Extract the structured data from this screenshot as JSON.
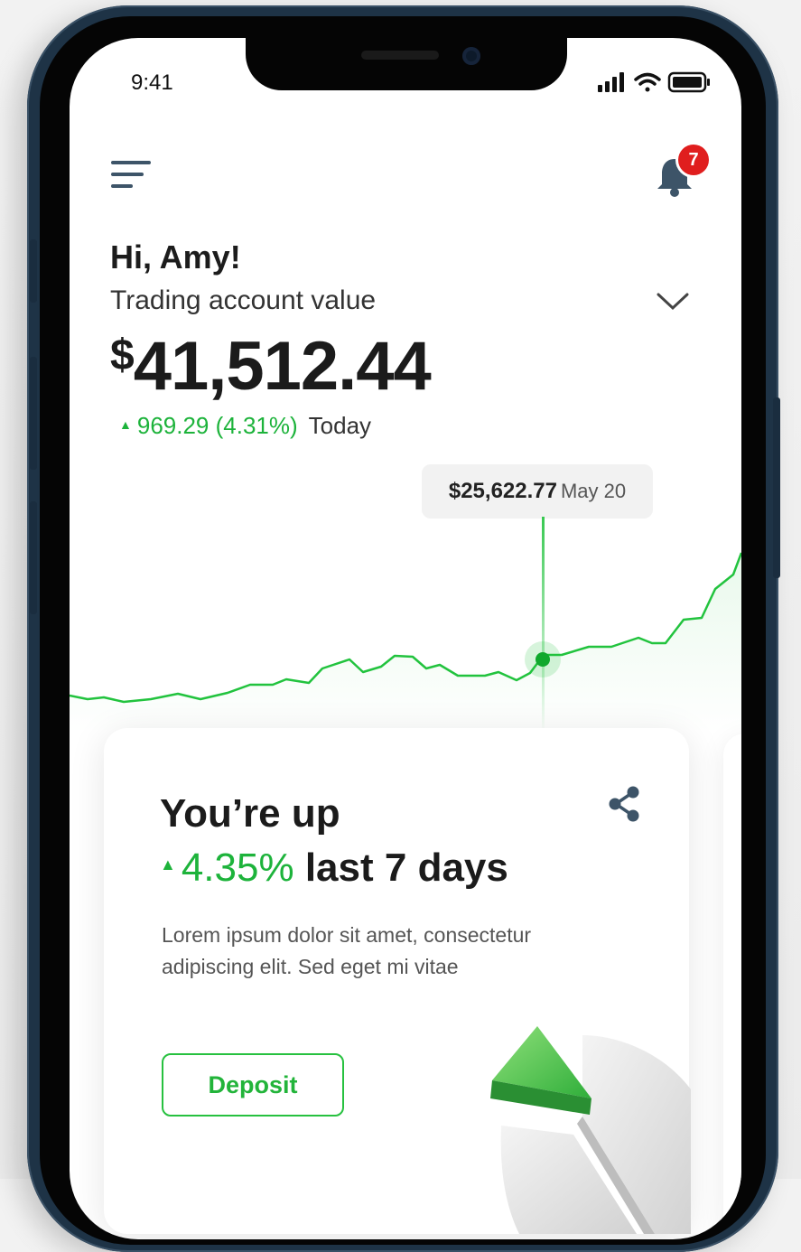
{
  "status_bar": {
    "time": "9:41"
  },
  "header": {
    "notification_count": "7"
  },
  "greeting": "Hi, Amy!",
  "account": {
    "label": "Trading account value",
    "currency_symbol": "$",
    "value": "41,512.44",
    "change": "969.29 (4.31%)",
    "period": "Today"
  },
  "chart": {
    "tooltip_value": "$25,622.77",
    "tooltip_date": "May 20",
    "line_color": "#22c33e"
  },
  "card": {
    "title": "You’re up",
    "percent": "4.35%",
    "period": "last 7 days",
    "body": "Lorem ipsum dolor sit amet, consectetur adipiscing elit. Sed eget mi vitae",
    "button_label": "Deposit"
  },
  "colors": {
    "accent": "#1db33b",
    "badge": "#e01e1e",
    "frame": "#1e3346"
  }
}
